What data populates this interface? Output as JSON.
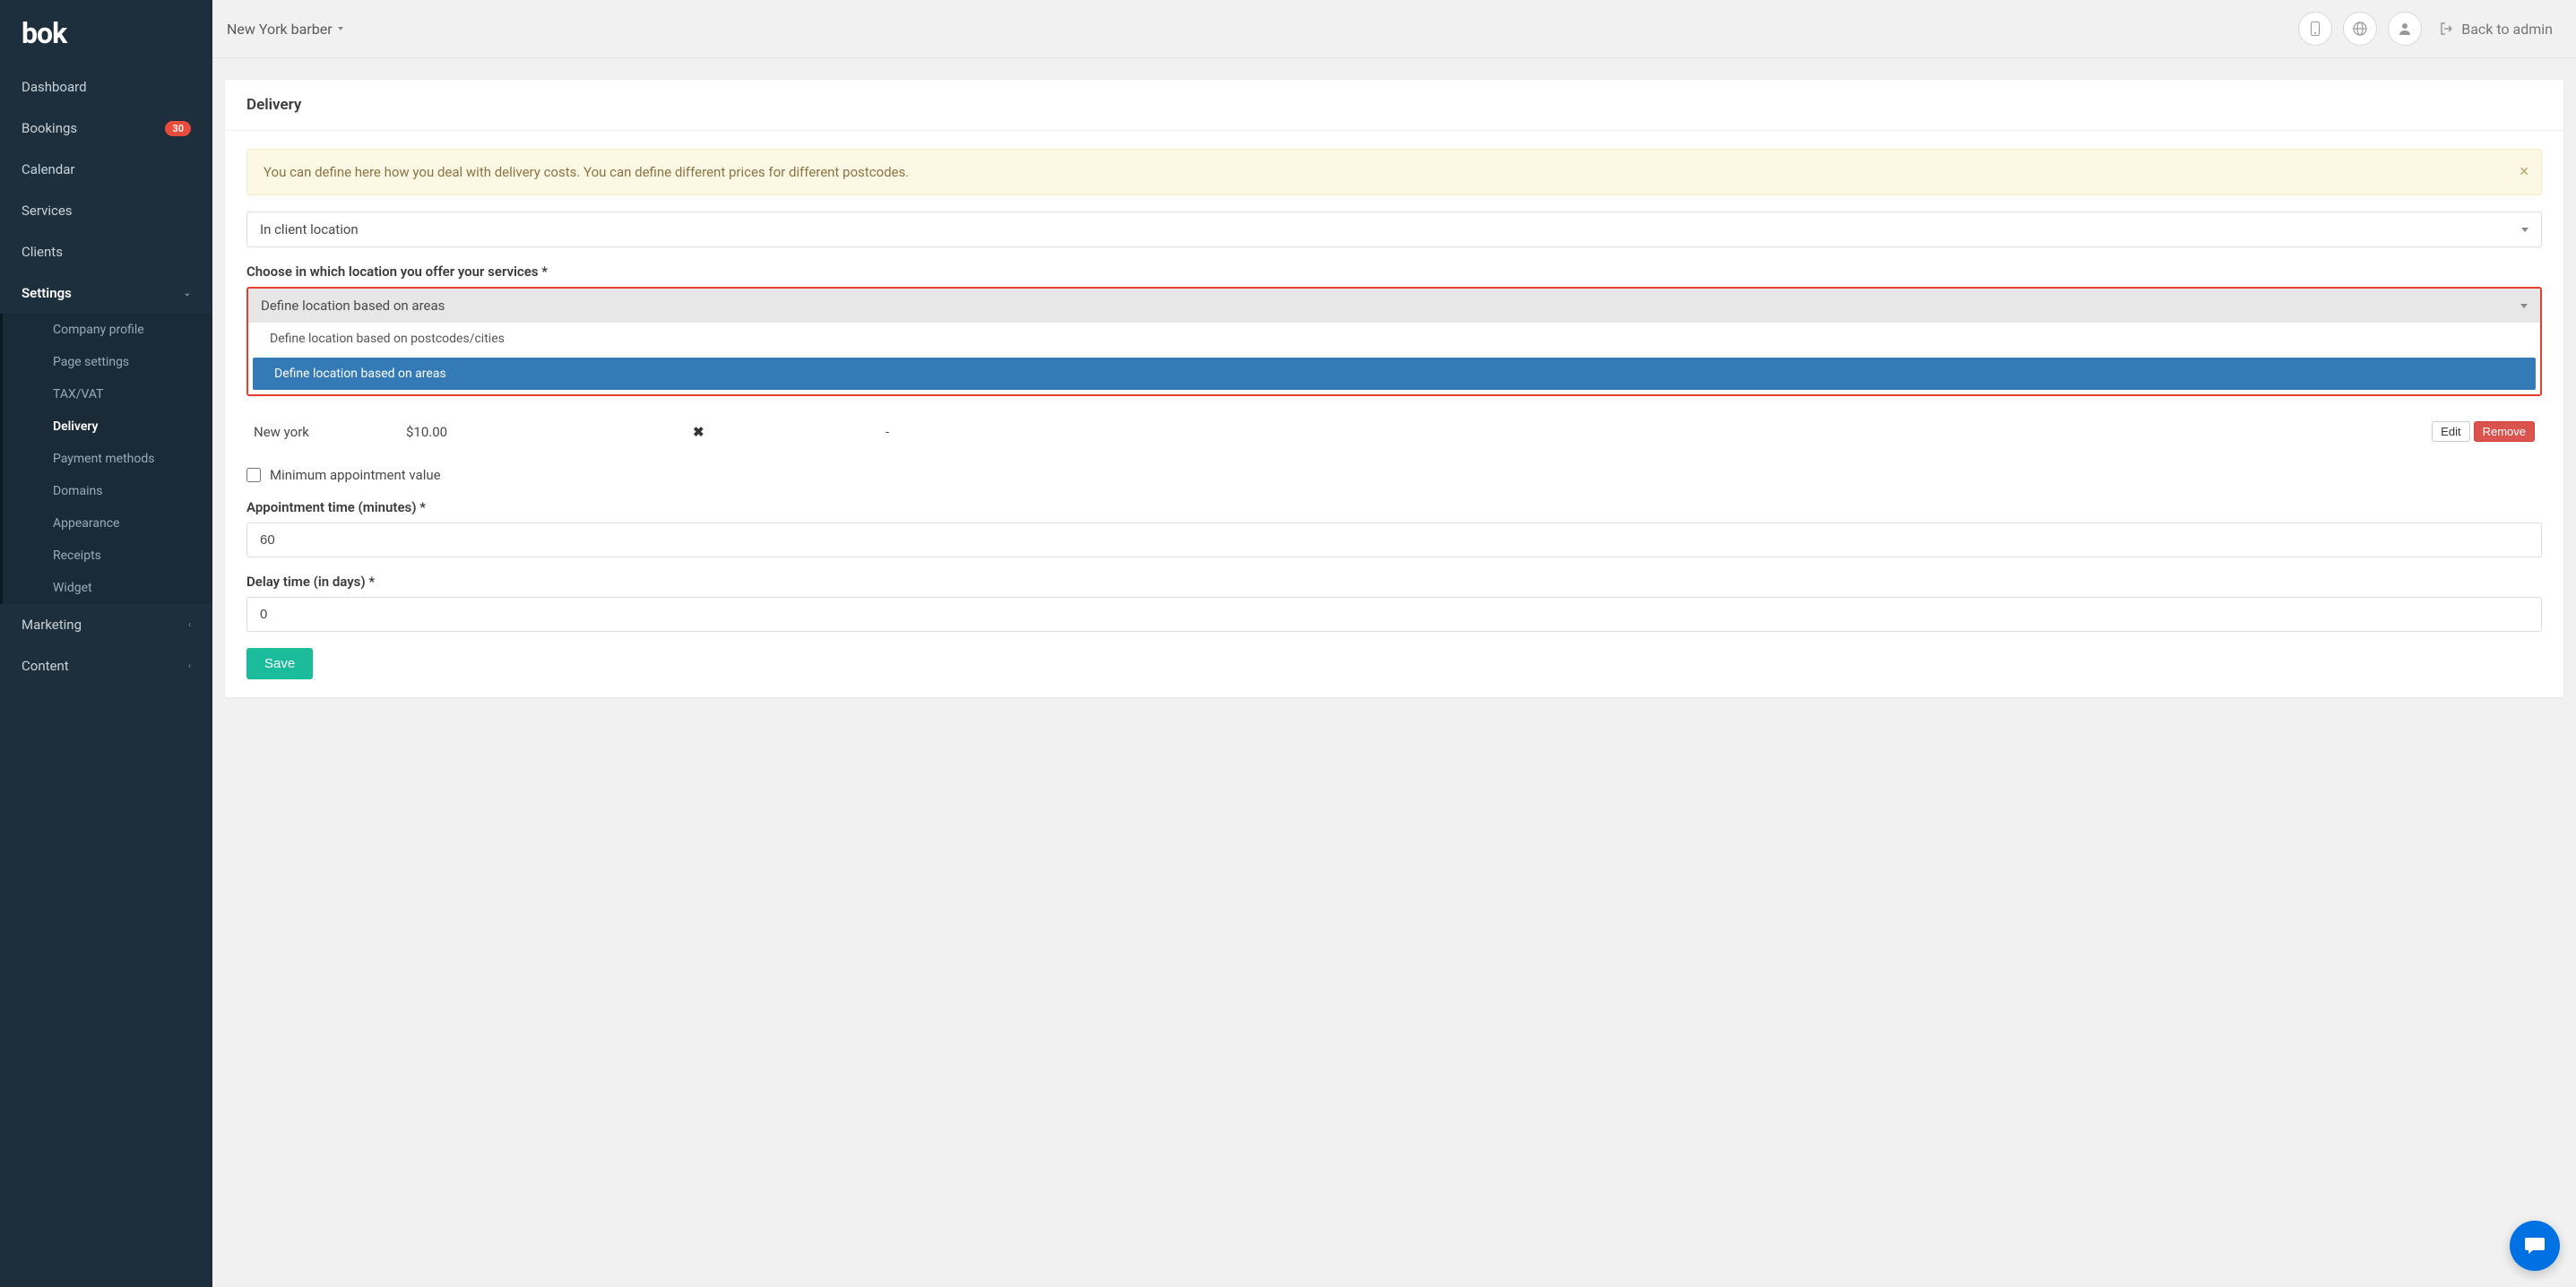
{
  "logo": "bok",
  "sidebar": {
    "items": [
      {
        "label": "Dashboard"
      },
      {
        "label": "Bookings",
        "badge": "30"
      },
      {
        "label": "Calendar"
      },
      {
        "label": "Services"
      },
      {
        "label": "Clients"
      }
    ],
    "settings_label": "Settings",
    "settings_subitems": [
      {
        "label": "Company profile"
      },
      {
        "label": "Page settings"
      },
      {
        "label": "TAX/VAT"
      },
      {
        "label": "Delivery",
        "active": true
      },
      {
        "label": "Payment methods"
      },
      {
        "label": "Domains"
      },
      {
        "label": "Appearance"
      },
      {
        "label": "Receipts"
      },
      {
        "label": "Widget"
      }
    ],
    "marketing_label": "Marketing",
    "content_label": "Content"
  },
  "header": {
    "location": "New York barber",
    "back_label": "Back to admin"
  },
  "page": {
    "title": "Delivery",
    "alert": "You can define here how you deal with delivery costs. You can define different prices for different postcodes.",
    "location_select_value": "In client location",
    "choose_location_label": "Choose in which location you offer your services *",
    "define_select_value": "Define location based on areas",
    "dropdown_options": [
      {
        "label": "Define location based on postcodes/cities"
      },
      {
        "label": "Define location based on areas",
        "selected": true
      }
    ],
    "table_row": {
      "name": "New york",
      "price": "$10.00",
      "icon": "✖",
      "dash": "-",
      "edit_label": "Edit",
      "remove_label": "Remove"
    },
    "min_appointment_label": "Minimum appointment value",
    "appointment_time_label": "Appointment time (minutes) *",
    "appointment_time_value": "60",
    "delay_time_label": "Delay time (in days) *",
    "delay_time_value": "0",
    "save_label": "Save"
  }
}
